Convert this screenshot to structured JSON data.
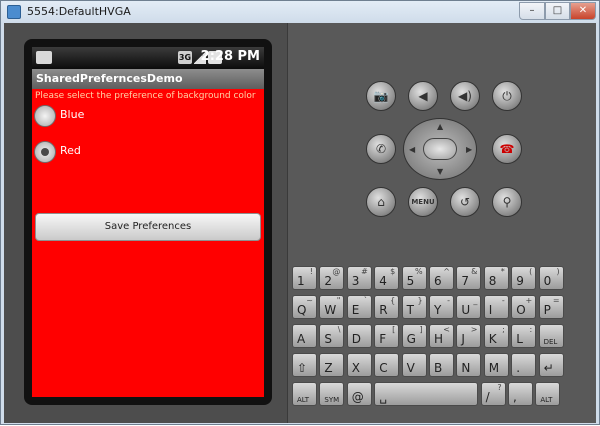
{
  "window": {
    "title": "5554:DefaultHVGA",
    "min": "–",
    "max": "□",
    "close": "✕"
  },
  "device": {
    "status_time": "2:28 PM",
    "status_3g": "3G",
    "app_title": "SharedPreferncesDemo",
    "prompt": "Please select the preference of background color",
    "radios": [
      {
        "label": "Blue",
        "checked": false
      },
      {
        "label": "Red",
        "checked": true
      }
    ],
    "save_button": "Save Preferences",
    "content_color": "#ff0000"
  },
  "controls": {
    "camera": "📷",
    "vol_down": "◀",
    "vol_up": "◀)",
    "power": "⏻",
    "call": "✆",
    "end_call": "☎",
    "home": "⌂",
    "menu": "MENU",
    "back": "↺",
    "search": "⚲"
  },
  "keyboard": {
    "row1": [
      [
        "1",
        "!"
      ],
      [
        "2",
        "@"
      ],
      [
        "3",
        "#"
      ],
      [
        "4",
        "$"
      ],
      [
        "5",
        "%"
      ],
      [
        "6",
        "^"
      ],
      [
        "7",
        "&"
      ],
      [
        "8",
        "*"
      ],
      [
        "9",
        "("
      ],
      [
        "0",
        ")"
      ]
    ],
    "row2": [
      [
        "Q",
        "~"
      ],
      [
        "W",
        "\""
      ],
      [
        "E",
        "`"
      ],
      [
        "R",
        "{"
      ],
      [
        "T",
        "}"
      ],
      [
        "Y",
        "-"
      ],
      [
        "U",
        "_"
      ],
      [
        "I",
        "-"
      ],
      [
        "O",
        "+"
      ],
      [
        "P",
        "="
      ]
    ],
    "row3": [
      [
        "A",
        ""
      ],
      [
        "S",
        "\\"
      ],
      [
        "D",
        ""
      ],
      [
        "F",
        "["
      ],
      [
        "G",
        "]"
      ],
      [
        "H",
        "<"
      ],
      [
        "J",
        ">"
      ],
      [
        "K",
        ";"
      ],
      [
        "L",
        ":"
      ],
      [
        "DEL",
        ""
      ]
    ],
    "row4": [
      [
        "⇧",
        ""
      ],
      [
        "Z",
        ""
      ],
      [
        "X",
        ""
      ],
      [
        "C",
        ""
      ],
      [
        "V",
        ""
      ],
      [
        "B",
        ""
      ],
      [
        "N",
        ""
      ],
      [
        "M",
        ""
      ],
      [
        ".",
        ""
      ],
      [
        "↵",
        ""
      ]
    ],
    "row5": [
      [
        "ALT",
        ""
      ],
      [
        "SYM",
        ""
      ],
      [
        "@",
        ""
      ],
      [
        "␣",
        ""
      ],
      [
        "/",
        "?"
      ],
      [
        ",",
        ""
      ],
      [
        "ALT",
        ""
      ]
    ]
  }
}
